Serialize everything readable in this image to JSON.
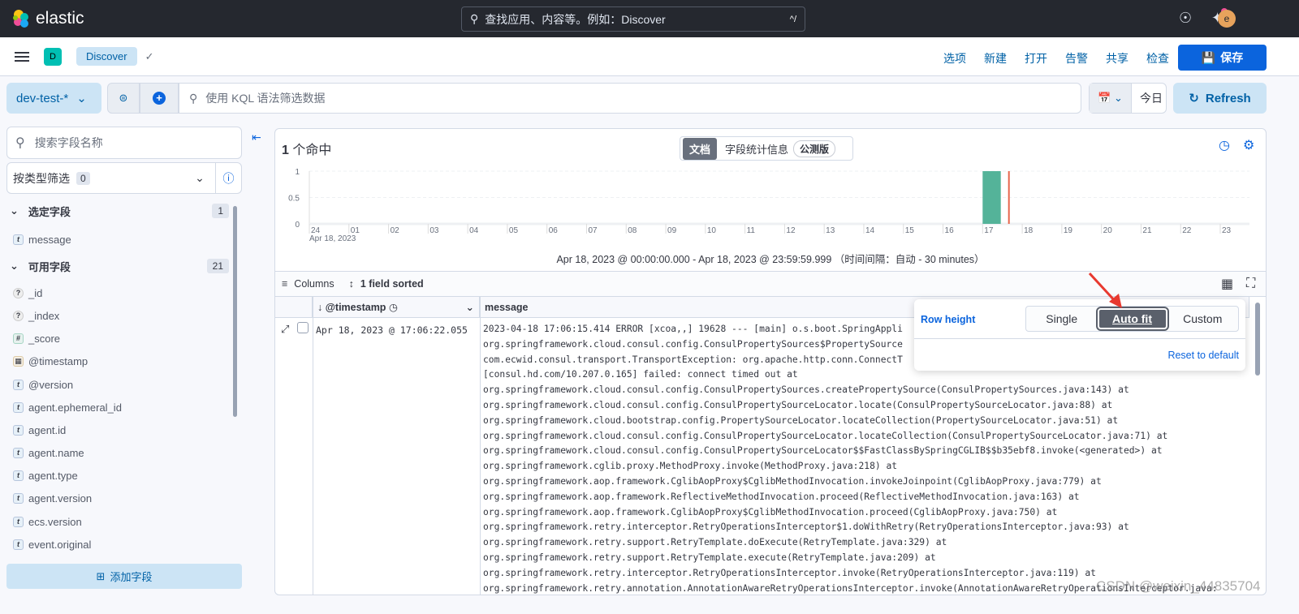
{
  "header": {
    "brand": "elastic",
    "search_placeholder": "查找应用、内容等。例如：Discover",
    "search_shortcut": "^/",
    "avatar": "e"
  },
  "nav": {
    "space": "D",
    "breadcrumb": "Discover",
    "menu": [
      "选项",
      "新建",
      "打开",
      "告警",
      "共享",
      "检查"
    ],
    "save": "保存"
  },
  "query": {
    "data_view": "dev-test-*",
    "kql_placeholder": "使用 KQL 语法筛选数据",
    "date": "今日",
    "refresh": "Refresh"
  },
  "sidebar": {
    "search_placeholder": "搜索字段名称",
    "type_filter": "按类型筛选",
    "type_filter_count": "0",
    "selected_title": "选定字段",
    "selected_count": "1",
    "selected": [
      {
        "type": "t",
        "name": "message"
      }
    ],
    "available_title": "可用字段",
    "available_count": "21",
    "available": [
      {
        "type": "?",
        "name": "_id"
      },
      {
        "type": "?",
        "name": "_index"
      },
      {
        "type": "#",
        "name": "_score"
      },
      {
        "type": "date",
        "name": "@timestamp"
      },
      {
        "type": "t",
        "name": "@version"
      },
      {
        "type": "t",
        "name": "agent.ephemeral_id"
      },
      {
        "type": "t",
        "name": "agent.id"
      },
      {
        "type": "t",
        "name": "agent.name"
      },
      {
        "type": "t",
        "name": "agent.type"
      },
      {
        "type": "t",
        "name": "agent.version"
      },
      {
        "type": "t",
        "name": "ecs.version"
      },
      {
        "type": "t",
        "name": "event.original"
      }
    ],
    "add_field": "添加字段"
  },
  "results": {
    "hits_count": "1",
    "hits_label": "个命中",
    "tab_documents": "文档",
    "tab_field_stats": "字段统计信息",
    "beta": "公测版",
    "range": "Apr 18, 2023 @ 00:00:00.000 - Apr 18, 2023 @ 23:59:59.999  （时间间隔：自动 - 30 minutes）"
  },
  "chart_data": {
    "type": "bar",
    "x_ticks": [
      "24",
      "01",
      "02",
      "03",
      "04",
      "05",
      "06",
      "07",
      "08",
      "09",
      "10",
      "11",
      "12",
      "13",
      "14",
      "15",
      "16",
      "17",
      "18",
      "19",
      "20",
      "21",
      "22",
      "23"
    ],
    "x_sublabel": "Apr 18, 2023",
    "y_ticks": [
      "0",
      "0.5",
      "1"
    ],
    "ylim": [
      0,
      1
    ],
    "interval_minutes": 30,
    "bars": [
      {
        "start": "17:00",
        "value": 1
      }
    ],
    "now_marker": "17:30",
    "bar_color": "#54b399",
    "marker_color": "#e7664c",
    "grid": true
  },
  "grid": {
    "columns_label": "Columns",
    "sort_label": "1 field sorted",
    "col_timestamp": "@timestamp",
    "col_message": "message",
    "rows": [
      {
        "timestamp": "Apr 18, 2023 @ 17:06:22.055",
        "message": [
          "2023-04-18 17:06:15.414 ERROR [xcoa,,] 19628 --- [main] o.s.boot.SpringAppli",
          "org.springframework.cloud.consul.config.ConsulPropertySources$PropertySource",
          "com.ecwid.consul.transport.TransportException: org.apache.http.conn.ConnectT",
          "[consul.hd.com/10.207.0.165] failed: connect timed out at",
          "org.springframework.cloud.consul.config.ConsulPropertySources.createPropertySource(ConsulPropertySources.java:143) at",
          "org.springframework.cloud.consul.config.ConsulPropertySourceLocator.locate(ConsulPropertySourceLocator.java:88) at",
          "org.springframework.cloud.bootstrap.config.PropertySourceLocator.locateCollection(PropertySourceLocator.java:51) at",
          "org.springframework.cloud.consul.config.ConsulPropertySourceLocator.locateCollection(ConsulPropertySourceLocator.java:71) at",
          "org.springframework.cloud.consul.config.ConsulPropertySourceLocator$$FastClassBySpringCGLIB$$b35ebf8.invoke(<generated>) at",
          "org.springframework.cglib.proxy.MethodProxy.invoke(MethodProxy.java:218) at",
          "org.springframework.aop.framework.CglibAopProxy$CglibMethodInvocation.invokeJoinpoint(CglibAopProxy.java:779) at",
          "org.springframework.aop.framework.ReflectiveMethodInvocation.proceed(ReflectiveMethodInvocation.java:163) at",
          "org.springframework.aop.framework.CglibAopProxy$CglibMethodInvocation.proceed(CglibAopProxy.java:750) at",
          "org.springframework.retry.interceptor.RetryOperationsInterceptor$1.doWithRetry(RetryOperationsInterceptor.java:93) at",
          "org.springframework.retry.support.RetryTemplate.doExecute(RetryTemplate.java:329) at",
          "org.springframework.retry.support.RetryTemplate.execute(RetryTemplate.java:209) at",
          "org.springframework.retry.interceptor.RetryOperationsInterceptor.invoke(RetryOperationsInterceptor.java:119) at",
          "org.springframework.retry.annotation.AnnotationAwareRetryOperationsInterceptor.invoke(AnnotationAwareRetryOperationsInterceptor.java:"
        ]
      }
    ]
  },
  "row_height_popover": {
    "label": "Row height",
    "options": [
      "Single",
      "Auto fit",
      "Custom"
    ],
    "selected": "Auto fit",
    "reset": "Reset to default"
  },
  "watermark": "CSDN @weixin_44835704"
}
